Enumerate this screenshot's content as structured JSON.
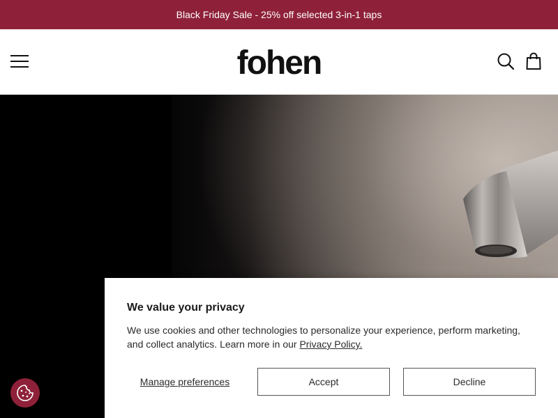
{
  "promo": {
    "text": "Black Friday Sale - 25% off selected 3-in-1 taps"
  },
  "header": {
    "logo_text": "fohen",
    "menu_icon": "hamburger-menu-icon",
    "search_icon": "search-icon",
    "cart_icon": "shopping-bag-icon"
  },
  "hero": {
    "image": "chrome-tap-spout"
  },
  "cookie_banner": {
    "title": "We value your privacy",
    "text": "We use cookies and other technologies to personalize your experience, perform marketing, and collect analytics. Learn more in our ",
    "privacy_link": "Privacy Policy.",
    "manage_label": "Manage preferences",
    "accept_label": "Accept",
    "decline_label": "Decline"
  },
  "cookie_fab": {
    "icon": "cookie-icon"
  },
  "colors": {
    "brand": "#8e2139",
    "hero_background": "#000000"
  }
}
